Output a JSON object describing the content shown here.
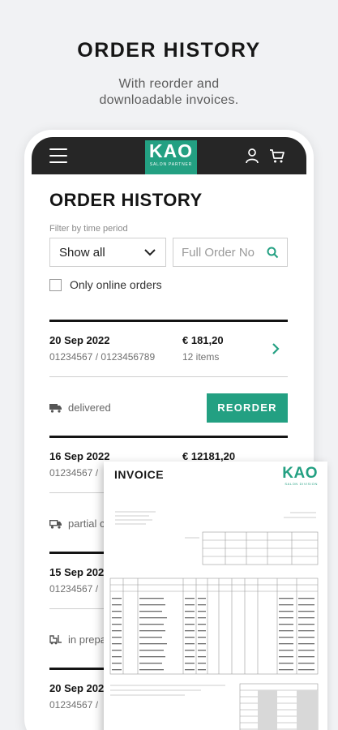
{
  "promo": {
    "title": "ORDER HISTORY",
    "subtitle_line1": "With reorder and",
    "subtitle_line2": "downloadable invoices."
  },
  "header": {
    "logo_brand": "KAO",
    "logo_tagline": "SALON PARTNER",
    "menu_icon": "hamburger-menu-icon",
    "account_icon": "user-icon",
    "cart_icon": "cart-icon"
  },
  "page": {
    "title": "ORDER HISTORY",
    "filter_label": "Filter by time period",
    "period_select": "Show all",
    "search_placeholder": "Full Order No",
    "online_only_label": "Only online orders"
  },
  "orders": [
    {
      "date": "20 Sep 2022",
      "numbers": "01234567 / 0123456789",
      "amount": "€ 181,20",
      "items": "12 items",
      "status": "delivered",
      "reorder": "REORDER"
    },
    {
      "date": "16 Sep 2022",
      "numbers": "01234567 /",
      "amount": "€ 12181,20",
      "status": "partial c"
    },
    {
      "date": "15 Sep 202",
      "numbers": "01234567 /",
      "status": "in prepa"
    },
    {
      "date": "20 Sep 202",
      "numbers": "01234567 /"
    }
  ],
  "invoice": {
    "title": "INVOICE",
    "logo_brand": "KAO",
    "logo_tagline": "SALON DIVISION"
  },
  "colors": {
    "accent": "#23a082",
    "topbar": "#262626",
    "background": "#f1f2f4"
  }
}
